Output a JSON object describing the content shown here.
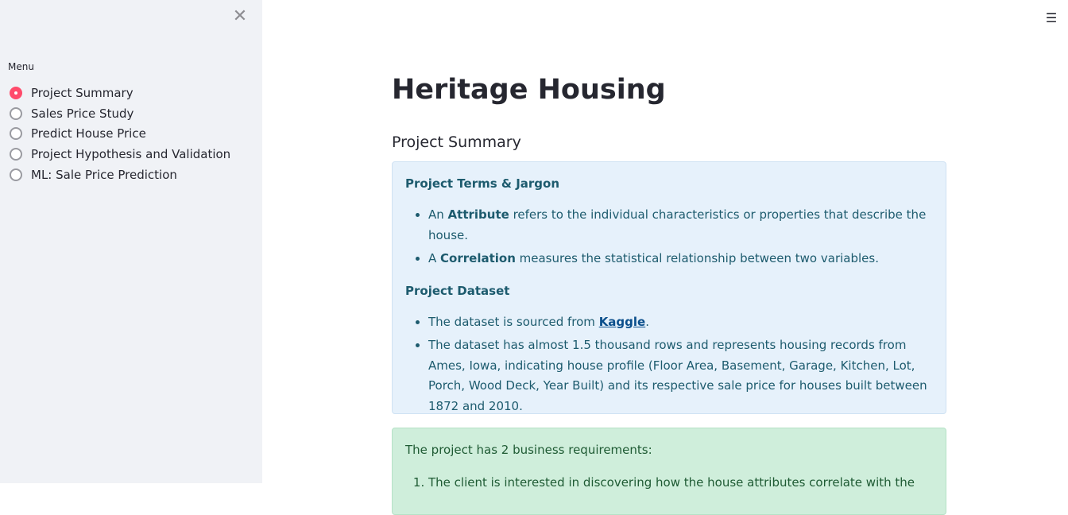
{
  "sidebar": {
    "menu_label": "Menu",
    "options": [
      {
        "label": "Project Summary",
        "selected": true
      },
      {
        "label": "Sales Price Study",
        "selected": false
      },
      {
        "label": "Predict House Price",
        "selected": false
      },
      {
        "label": "Project Hypothesis and Validation",
        "selected": false
      },
      {
        "label": "ML: Sale Price Prediction",
        "selected": false
      }
    ],
    "close_icon": "close-icon"
  },
  "header": {
    "menu_icon": "hamburger-icon"
  },
  "main": {
    "title": "Heritage Housing",
    "section_title": "Project Summary",
    "info_box": {
      "heading1": "Project Terms & Jargon",
      "term1": {
        "pre": "An ",
        "bold": "Attribute",
        "post": " refers to the individual characteristics or properties that describe the house."
      },
      "term2": {
        "pre": "A ",
        "bold": "Correlation",
        "post": " measures the statistical relationship between two variables."
      },
      "heading2": "Project Dataset",
      "dataset1": {
        "pre": "The dataset is sourced from ",
        "link": "Kaggle",
        "post": "."
      },
      "dataset2": "The dataset has almost 1.5 thousand rows and represents housing records from Ames, Iowa, indicating house profile (Floor Area, Basement, Garage, Kitchen, Lot, Porch, Wood Deck, Year Built) and its respective sale price for houses built between 1872 and 2010."
    },
    "success_box": {
      "intro": "The project has 2 business requirements:",
      "item1": "The client is interested in discovering how the house attributes correlate with the"
    }
  },
  "colors": {
    "sidebar_bg": "#f0f2f6",
    "accent": "#ff4b6b",
    "info_bg": "#e6f1fb",
    "info_text": "#1d5b6e",
    "success_bg": "#cfeedb",
    "success_text": "#1f5b34"
  }
}
